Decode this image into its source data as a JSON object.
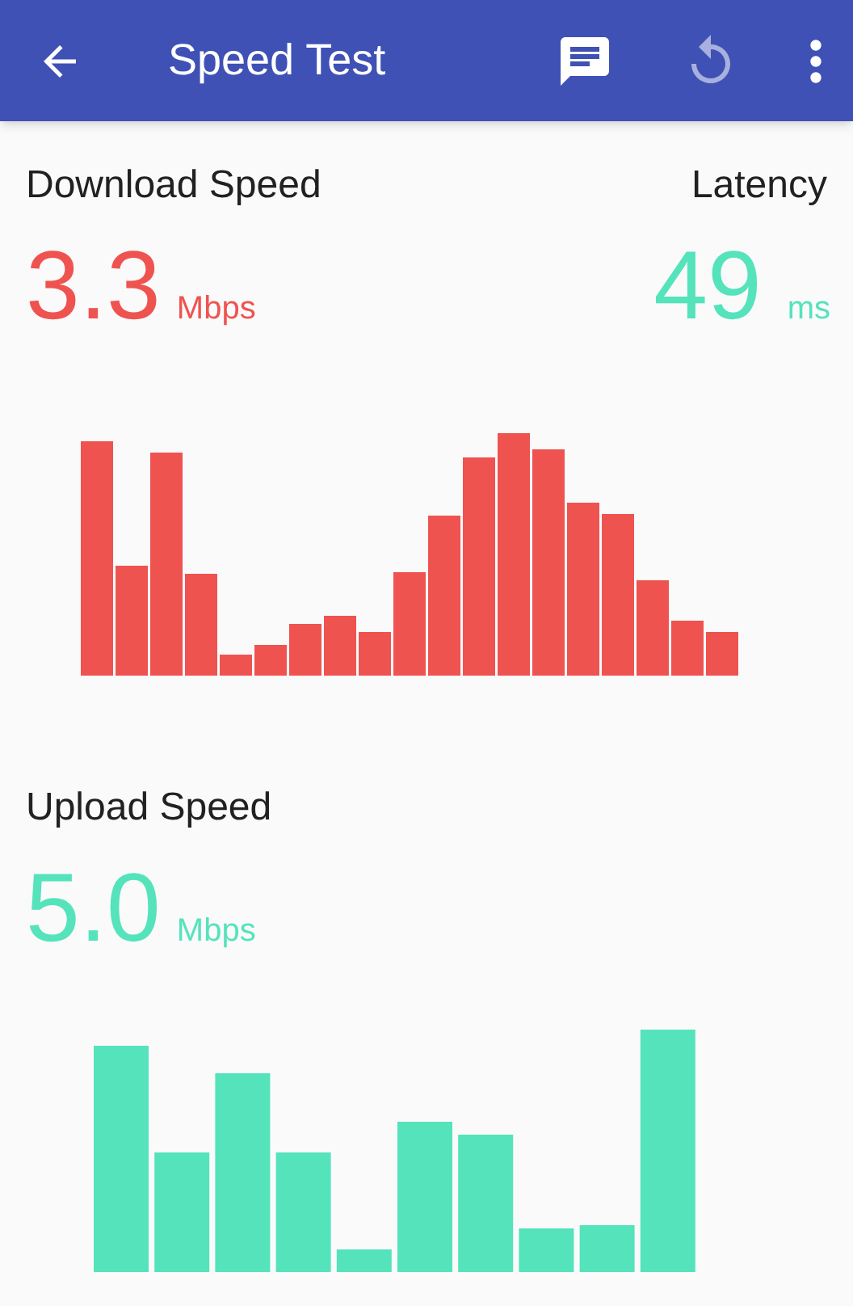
{
  "app_bar": {
    "title": "Speed Test",
    "actions": [
      {
        "kind": "message",
        "disabled": false
      },
      {
        "kind": "refresh",
        "disabled": true
      },
      {
        "kind": "more",
        "disabled": false
      }
    ]
  },
  "download": {
    "label": "Download Speed",
    "value": "3.3",
    "unit": "Mbps",
    "color": "#ef5350"
  },
  "latency": {
    "label": "Latency",
    "value": "49",
    "unit": "ms",
    "color": "#55e3bc"
  },
  "upload": {
    "label": "Upload Speed",
    "value": "5.0",
    "unit": "Mbps",
    "color": "#55e3bc"
  }
}
